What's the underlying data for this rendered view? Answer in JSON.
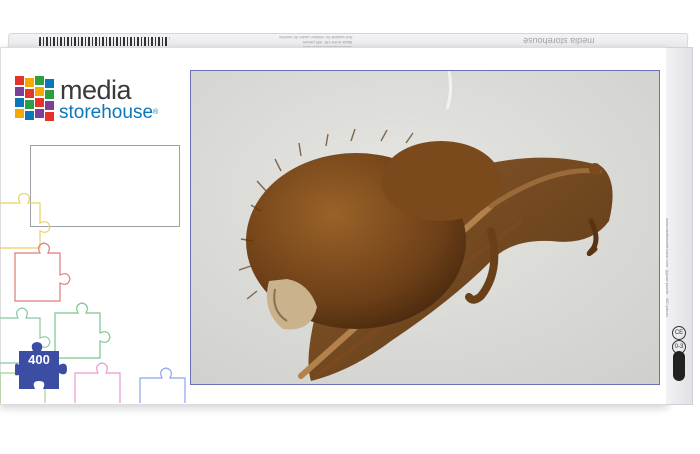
{
  "product": {
    "brand_line1": "media",
    "brand_line2": "storehouse",
    "brand_mark": "®",
    "piece_count": "400",
    "top_brand": "media storehouse",
    "top_fine_1": "www.mediastorehouse.com",
    "top_fine_2": "Made in the UK. 400 pieces",
    "top_fine_3": "Not suitable for children under 36 months",
    "side_fine": "www.mediastorehouse.com · jigsaw puzzle · 400 pieces"
  },
  "image": {
    "subject": "bat"
  },
  "colors": {
    "brand_blue": "#0a76bc",
    "badge_blue": "#3b4ea3",
    "photo_border": "#6b6fb8"
  },
  "icons": [
    "logo-grid-icon",
    "puzzle-piece-icon",
    "puzzle-badge-icon",
    "ce-icon",
    "age-warning-icon"
  ]
}
